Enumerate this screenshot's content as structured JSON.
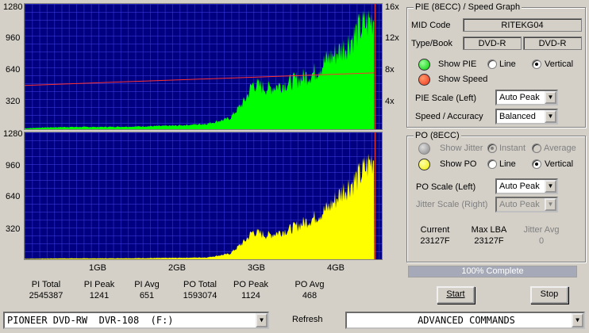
{
  "graph": {
    "pie_left_ticks": [
      "1280",
      "960",
      "640",
      "320"
    ],
    "pie_right_ticks": [
      "16x",
      "12x",
      "8x",
      "4x"
    ],
    "po_left_ticks": [
      "1280",
      "960",
      "640",
      "320"
    ],
    "x_ticks": [
      "1GB",
      "2GB",
      "3GB",
      "4GB"
    ],
    "colors": {
      "background": "#000080",
      "pie": "#00ff00",
      "po": "#ffff00",
      "speed": "#ff3030",
      "divider": "#ffffff"
    }
  },
  "chart_data": [
    {
      "type": "area",
      "name": "pie",
      "x_unit": "GB",
      "y_range": [
        0,
        1280
      ],
      "x_range": [
        0,
        4.7
      ],
      "series": [
        {
          "x": [
            0,
            0.3,
            0.6,
            1.0,
            1.5,
            2.0,
            2.4,
            2.7,
            2.9,
            3.0,
            3.2,
            3.5,
            3.8,
            4.0,
            4.2,
            4.4,
            4.6
          ],
          "values": [
            10,
            20,
            25,
            25,
            30,
            40,
            60,
            120,
            320,
            500,
            450,
            520,
            620,
            780,
            900,
            1100,
            1241
          ]
        }
      ],
      "secondary_series": {
        "y_range": [
          0,
          16
        ],
        "x": [
          0,
          4.6
        ],
        "values": [
          5.6,
          7.2
        ]
      }
    },
    {
      "type": "area",
      "name": "po",
      "x_unit": "GB",
      "y_range": [
        0,
        1280
      ],
      "x_range": [
        0,
        4.7
      ],
      "series": [
        {
          "x": [
            0,
            0.5,
            1.0,
            1.5,
            2.0,
            2.4,
            2.7,
            2.9,
            3.0,
            3.2,
            3.5,
            3.8,
            4.0,
            4.2,
            4.4,
            4.6
          ],
          "values": [
            5,
            10,
            10,
            12,
            15,
            20,
            60,
            200,
            300,
            260,
            330,
            450,
            560,
            760,
            900,
            1124
          ]
        }
      ]
    }
  ],
  "pie_panel": {
    "title": "PIE (8ECC) / Speed Graph",
    "mid_label": "MID Code",
    "mid_value": "RITEKG04",
    "type_label": "Type/Book",
    "type_value": "DVD-R",
    "book_value": "DVD-R",
    "show_pie": "Show PIE",
    "show_speed": "Show Speed",
    "line": "Line",
    "vertical": "Vertical",
    "scale_label": "PIE Scale (Left)",
    "scale_value": "Auto Peak",
    "speed_label": "Speed / Accuracy",
    "speed_value": "Balanced"
  },
  "po_panel": {
    "title": "PO (8ECC)",
    "show_jitter": "Show Jitter",
    "instant": "Instant",
    "average": "Average",
    "show_po": "Show PO",
    "line": "Line",
    "vertical": "Vertical",
    "scale_label": "PO Scale (Left)",
    "scale_value": "Auto Peak",
    "jitter_label": "Jitter Scale (Right)",
    "jitter_value": "Auto Peak",
    "current_label": "Current",
    "current_value": "23127F",
    "maxlba_label": "Max LBA",
    "maxlba_value": "23127F",
    "jitteravg_label": "Jitter Avg",
    "jitteravg_value": "0"
  },
  "progress": {
    "text": "100% Complete",
    "value": 1.0
  },
  "stats": [
    {
      "label": "PI Total",
      "value": "2545387"
    },
    {
      "label": "PI Peak",
      "value": "1241"
    },
    {
      "label": "PI Avg",
      "value": "651"
    },
    {
      "label": "PO Total",
      "value": "1593074"
    },
    {
      "label": "PO Peak",
      "value": "1124"
    },
    {
      "label": "PO Avg",
      "value": "468"
    }
  ],
  "buttons": {
    "start": "Start",
    "stop": "Stop",
    "refresh": "Refresh"
  },
  "drive": "PIONEER DVD-RW  DVR-108  (F:)",
  "commands": "ADVANCED COMMANDS"
}
